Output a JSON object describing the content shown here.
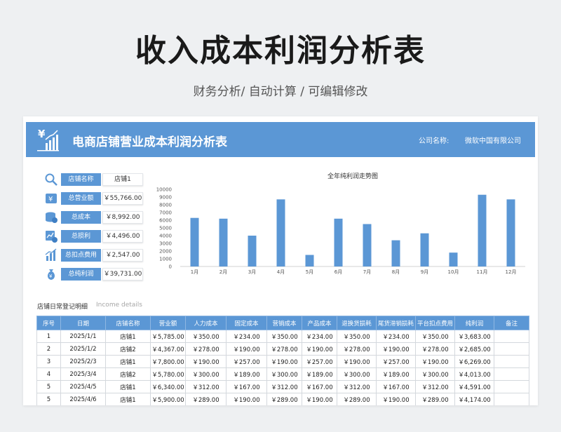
{
  "page": {
    "title": "收入成本利润分析表",
    "subtitle": "财务分析/ 自动计算 / 可编辑修改"
  },
  "banner": {
    "title": "电商店铺营业成本利润分析表",
    "company_label": "公司名称:",
    "company_value": "微软中国有限公司",
    "icon": "yen-growth-icon"
  },
  "kpis": [
    {
      "icon": "search-icon",
      "label": "店铺名称",
      "value": "店铺1"
    },
    {
      "icon": "yen-card-icon",
      "label": "总营业额",
      "value": "￥55,766.00"
    },
    {
      "icon": "coins-icon",
      "label": "总成本",
      "value": "￥8,992.00"
    },
    {
      "icon": "chart-yen-icon",
      "label": "总损利",
      "value": "￥4,496.00"
    },
    {
      "icon": "bar-growth-icon",
      "label": "总扣点费用",
      "value": "￥2,547.00"
    },
    {
      "icon": "money-bag-icon",
      "label": "总纯利润",
      "value": "￥39,731.00"
    }
  ],
  "chart_data": {
    "type": "bar",
    "title": "全年纯利润走势图",
    "categories": [
      "1月",
      "2月",
      "3月",
      "4月",
      "5月",
      "6月",
      "7月",
      "8月",
      "9月",
      "10月",
      "11月",
      "12月"
    ],
    "values": [
      6300,
      6200,
      4000,
      8700,
      1500,
      6200,
      5500,
      3400,
      4300,
      1800,
      9300,
      8700
    ],
    "ylim": [
      0,
      10000
    ],
    "yticks": [
      0,
      1000,
      2000,
      3000,
      4000,
      5000,
      6000,
      7000,
      8000,
      9000,
      10000
    ],
    "bar_color": "#5b97d5",
    "grid": false,
    "legend": "none"
  },
  "detail": {
    "title": "店铺日常登记明细",
    "subtitle_en": "Income details",
    "columns": [
      "序号",
      "日期",
      "店铺名称",
      "营业额",
      "人力成本",
      "固定成本",
      "营销成本",
      "产品成本",
      "退换货损耗",
      "尾货滞销损耗",
      "平台扣点费用",
      "纯利润",
      "备注"
    ],
    "rows": [
      [
        "1",
        "2025/1/1",
        "店铺1",
        "￥5,785.00",
        "￥350.00",
        "￥234.00",
        "￥350.00",
        "￥234.00",
        "￥350.00",
        "￥234.00",
        "￥350.00",
        "￥3,683.00",
        ""
      ],
      [
        "2",
        "2025/1/2",
        "店铺2",
        "￥4,367.00",
        "￥278.00",
        "￥190.00",
        "￥278.00",
        "￥190.00",
        "￥278.00",
        "￥190.00",
        "￥278.00",
        "￥2,685.00",
        ""
      ],
      [
        "3",
        "2025/2/3",
        "店铺1",
        "￥7,800.00",
        "￥190.00",
        "￥257.00",
        "￥190.00",
        "￥257.00",
        "￥190.00",
        "￥257.00",
        "￥190.00",
        "￥6,269.00",
        ""
      ],
      [
        "4",
        "2025/3/4",
        "店铺2",
        "￥5,780.00",
        "￥300.00",
        "￥189.00",
        "￥300.00",
        "￥189.00",
        "￥300.00",
        "￥189.00",
        "￥300.00",
        "￥4,013.00",
        ""
      ],
      [
        "5",
        "2025/4/5",
        "店铺1",
        "￥6,340.00",
        "￥312.00",
        "￥167.00",
        "￥312.00",
        "￥167.00",
        "￥312.00",
        "￥167.00",
        "￥312.00",
        "￥4,591.00",
        ""
      ],
      [
        "5",
        "2025/4/6",
        "店铺1",
        "￥5,900.00",
        "￥289.00",
        "￥190.00",
        "￥289.00",
        "￥190.00",
        "￥289.00",
        "￥190.00",
        "￥289.00",
        "￥4,174.00",
        ""
      ]
    ]
  }
}
